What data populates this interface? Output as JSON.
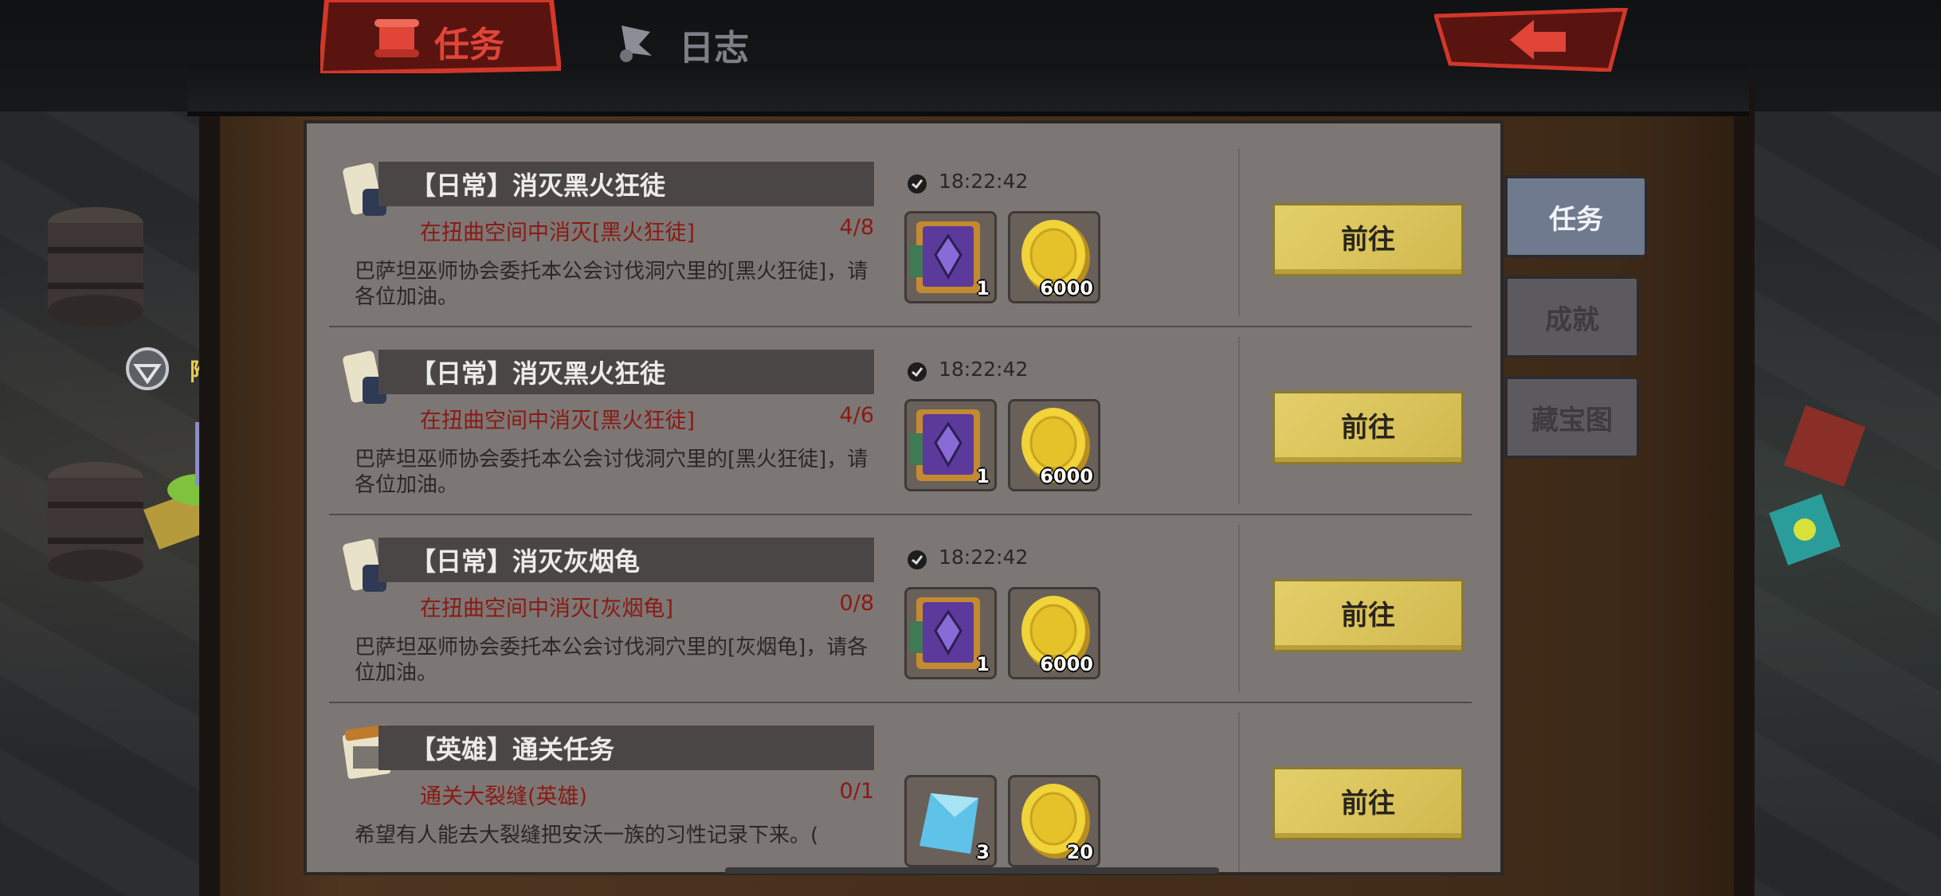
{
  "tabs": {
    "quests": "任务",
    "log": "日志"
  },
  "side_tabs": [
    "任务",
    "成就",
    "藏宝图"
  ],
  "side_hint": "附魔",
  "quests": [
    {
      "title": "【日常】消灭黑火狂徒",
      "objective": "在扭曲空间中消灭[黑火狂徒]",
      "progress": "4/8",
      "description": "巴萨坦巫师协会委托本公会讨伐洞穴里的[黑火狂徒]，请各位加油。",
      "timer": "18:22:42",
      "rewards": [
        {
          "icon": "purple-tome-icon",
          "count": "1"
        },
        {
          "icon": "gold-coin-icon",
          "count": "6000"
        }
      ],
      "button": "前往"
    },
    {
      "title": "【日常】消灭黑火狂徒",
      "objective": "在扭曲空间中消灭[黑火狂徒]",
      "progress": "4/6",
      "description": "巴萨坦巫师协会委托本公会讨伐洞穴里的[黑火狂徒]，请各位加油。",
      "timer": "18:22:42",
      "rewards": [
        {
          "icon": "purple-tome-icon",
          "count": "1"
        },
        {
          "icon": "gold-coin-icon",
          "count": "6000"
        }
      ],
      "button": "前往"
    },
    {
      "title": "【日常】消灭灰烟龟",
      "objective": "在扭曲空间中消灭[灰烟龟]",
      "progress": "0/8",
      "description": "巴萨坦巫师协会委托本公会讨伐洞穴里的[灰烟龟]，请各位加油。",
      "timer": "18:22:42",
      "rewards": [
        {
          "icon": "purple-tome-icon",
          "count": "1"
        },
        {
          "icon": "gold-coin-icon",
          "count": "6000"
        }
      ],
      "button": "前往"
    },
    {
      "title": "【英雄】通关任务",
      "objective": "通关大裂缝(英雄)",
      "progress": "0/1",
      "description": "希望有人能去大裂缝把安沃一族的习性记录下来。(",
      "timer": "",
      "rewards": [
        {
          "icon": "blue-crystal-icon",
          "count": "3"
        },
        {
          "icon": "gold-coin-icon",
          "count": "20"
        }
      ],
      "button": "前往"
    }
  ]
}
